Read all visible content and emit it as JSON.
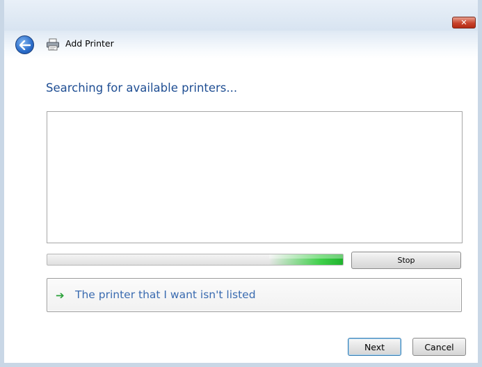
{
  "window": {
    "title": "Add Printer",
    "close_label": "✕"
  },
  "main": {
    "heading": "Searching for available printers...",
    "printers": []
  },
  "progress": {
    "fill_start": 0.75,
    "fill_end": 1.0,
    "accent_color": "#3fd04a"
  },
  "buttons": {
    "stop_label": "Stop",
    "next_label": "Next",
    "cancel_label": "Cancel"
  },
  "link": {
    "text": "The printer that I want isn't listed"
  },
  "icons": {
    "back": "back-arrow-icon",
    "printer": "printer-icon",
    "link_arrow": "green-arrow-icon"
  }
}
